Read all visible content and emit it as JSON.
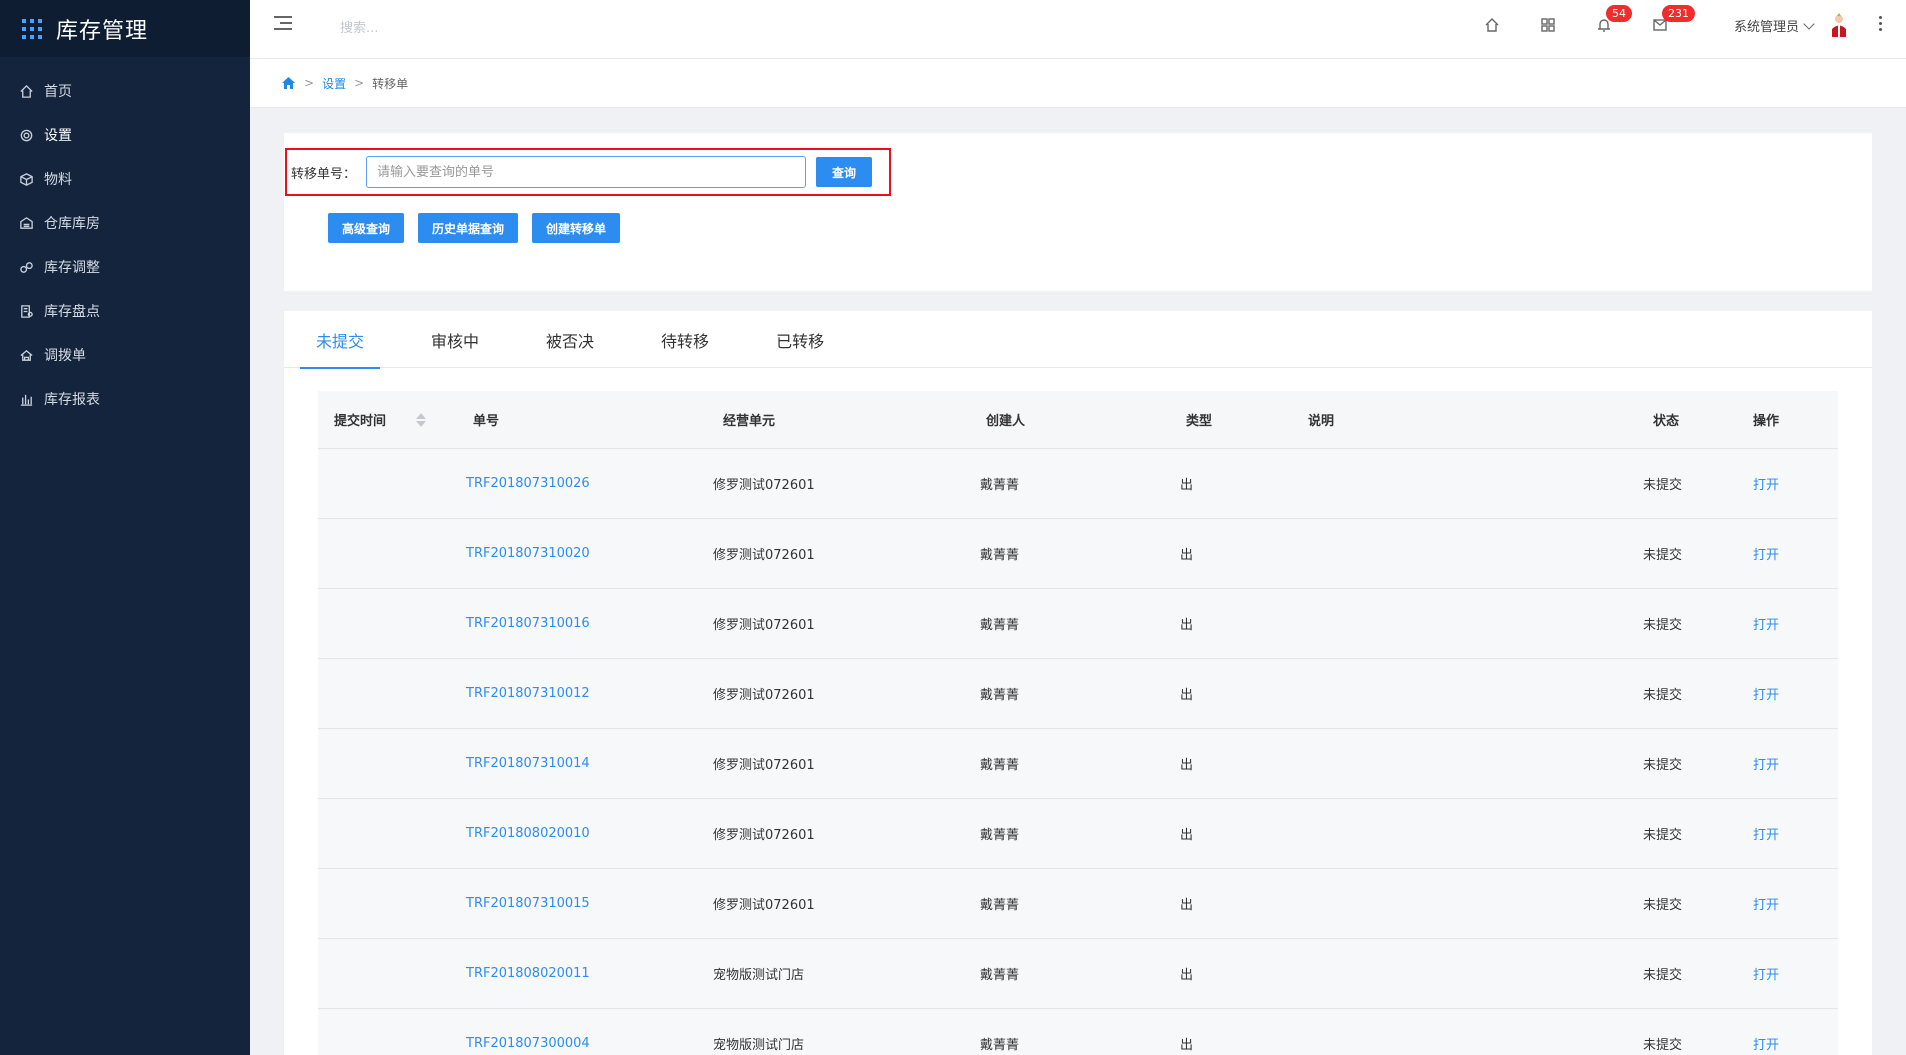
{
  "app": {
    "title": "库存管理"
  },
  "sidebar": {
    "items": [
      {
        "label": "首页",
        "icon": "home-icon"
      },
      {
        "label": "设置",
        "icon": "gear-icon"
      },
      {
        "label": "物料",
        "icon": "cube-icon"
      },
      {
        "label": "仓库库房",
        "icon": "warehouse-icon"
      },
      {
        "label": "库存调整",
        "icon": "adjust-icon"
      },
      {
        "label": "库存盘点",
        "icon": "inventory-check-icon"
      },
      {
        "label": "调拨单",
        "icon": "transfer-icon"
      },
      {
        "label": "库存报表",
        "icon": "bar-chart-icon"
      }
    ]
  },
  "header": {
    "search_placeholder": "搜索...",
    "notifications_count": "54",
    "messages_count": "231",
    "user_name": "系统管理员"
  },
  "breadcrumb": {
    "current": "转移单",
    "parent": "设置"
  },
  "query": {
    "label": "转移单号：",
    "placeholder": "请输入要查询的单号",
    "search_button": "查询",
    "advanced_button": "高级查询",
    "history_button": "历史单据查询",
    "create_button": "创建转移单"
  },
  "tabs": [
    "未提交",
    "审核中",
    "被否决",
    "待转移",
    "已转移"
  ],
  "table": {
    "columns": {
      "time": "提交时间",
      "number": "单号",
      "unit": "经营单元",
      "creator": "创建人",
      "type": "类型",
      "desc": "说明",
      "status": "状态",
      "action": "操作"
    },
    "rows": [
      {
        "number": "TRF201807310026",
        "unit": "修罗测试072601",
        "creator": "戴菁菁",
        "type": "出",
        "status": "未提交",
        "action": "打开"
      },
      {
        "number": "TRF201807310020",
        "unit": "修罗测试072601",
        "creator": "戴菁菁",
        "type": "出",
        "status": "未提交",
        "action": "打开"
      },
      {
        "number": "TRF201807310016",
        "unit": "修罗测试072601",
        "creator": "戴菁菁",
        "type": "出",
        "status": "未提交",
        "action": "打开"
      },
      {
        "number": "TRF201807310012",
        "unit": "修罗测试072601",
        "creator": "戴菁菁",
        "type": "出",
        "status": "未提交",
        "action": "打开"
      },
      {
        "number": "TRF201807310014",
        "unit": "修罗测试072601",
        "creator": "戴菁菁",
        "type": "出",
        "status": "未提交",
        "action": "打开"
      },
      {
        "number": "TRF201808020010",
        "unit": "修罗测试072601",
        "creator": "戴菁菁",
        "type": "出",
        "status": "未提交",
        "action": "打开"
      },
      {
        "number": "TRF201807310015",
        "unit": "修罗测试072601",
        "creator": "戴菁菁",
        "type": "出",
        "status": "未提交",
        "action": "打开"
      },
      {
        "number": "TRF201808020011",
        "unit": "宠物版测试门店",
        "creator": "戴菁菁",
        "type": "出",
        "status": "未提交",
        "action": "打开"
      },
      {
        "number": "TRF201807300004",
        "unit": "宠物版测试门店",
        "creator": "戴菁菁",
        "type": "出",
        "status": "未提交",
        "action": "打开"
      }
    ]
  }
}
